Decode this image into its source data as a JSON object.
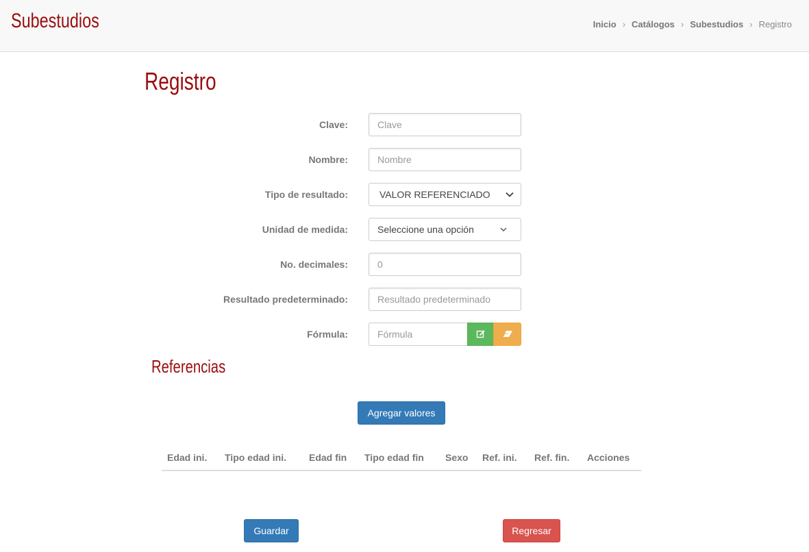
{
  "header": {
    "brand": "Subestudios",
    "breadcrumb": [
      "Inicio",
      "Catálogos",
      "Subestudios",
      "Registro"
    ]
  },
  "page": {
    "title": "Registro"
  },
  "form": {
    "clave": {
      "label": "Clave:",
      "placeholder": "Clave"
    },
    "nombre": {
      "label": "Nombre:",
      "placeholder": "Nombre"
    },
    "tipo_resultado": {
      "label": "Tipo de resultado:",
      "value": "VALOR REFERENCIADO"
    },
    "unidad_medida": {
      "label": "Unidad de medida:",
      "value": "Seleccione una opción"
    },
    "decimales": {
      "label": "No. decimales:",
      "placeholder": "0"
    },
    "resultado_predeterminado": {
      "label": "Resultado predeterminado:",
      "placeholder": "Resultado predeterminado"
    },
    "formula": {
      "label": "Fórmula:",
      "placeholder": "Fórmula"
    }
  },
  "referencias": {
    "title": "Referencias",
    "add_button": "Agregar valores",
    "columns": [
      "Edad ini.",
      "Tipo edad ini.",
      "Edad fin",
      "Tipo edad fin",
      "Sexo",
      "Ref. ini.",
      "Ref. fin.",
      "Acciones"
    ]
  },
  "actions": {
    "save": "Guardar",
    "back": "Regresar"
  },
  "colors": {
    "brand": "#9b0d0d",
    "primary": "#337ab7",
    "danger": "#d9534f",
    "success": "#5cb85c",
    "warning": "#f0ad4e"
  },
  "icons": {
    "edit": "edit-icon",
    "erase": "eraser-icon",
    "dropdown": "chevron-down-icon"
  }
}
